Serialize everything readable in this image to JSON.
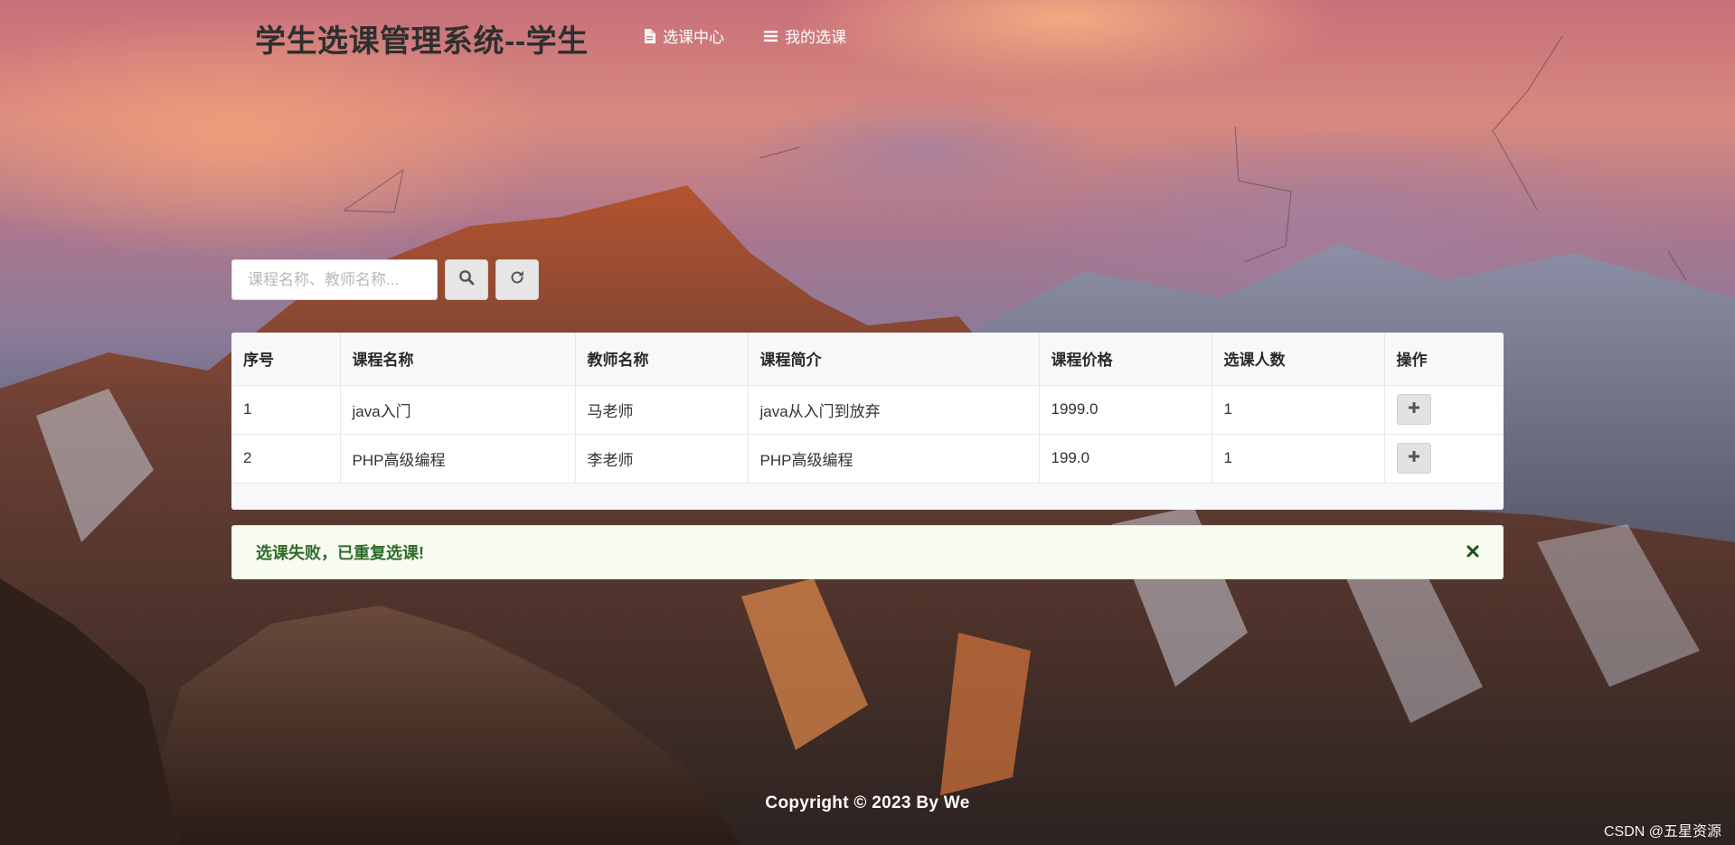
{
  "header": {
    "brand": "学生选课管理系统--学生",
    "nav": [
      {
        "label": "选课中心",
        "icon": "document-icon"
      },
      {
        "label": "我的选课",
        "icon": "list-icon"
      }
    ]
  },
  "search": {
    "placeholder": "课程名称、教师名称...",
    "value": "",
    "search_icon": "search-icon",
    "refresh_icon": "refresh-icon"
  },
  "table": {
    "columns": [
      "序号",
      "课程名称",
      "教师名称",
      "课程简介",
      "课程价格",
      "选课人数",
      "操作"
    ],
    "rows": [
      {
        "index": "1",
        "course": "java入门",
        "teacher": "马老师",
        "intro": "java从入门到放弃",
        "price": "1999.0",
        "count": "1",
        "action_icon": "plus-icon"
      },
      {
        "index": "2",
        "course": "PHP高级编程",
        "teacher": "李老师",
        "intro": "PHP高级编程",
        "price": "199.0",
        "count": "1",
        "action_icon": "plus-icon"
      }
    ]
  },
  "alert": {
    "message": "选课失败，已重复选课!",
    "close_icon": "close-icon"
  },
  "footer": {
    "copyright": "Copyright © 2023 By We",
    "watermark": "CSDN @五星资源"
  },
  "colors": {
    "alert_text": "#2f6b2a",
    "alert_bg": "#f7fbf0",
    "brand_text": "#2f2f2f"
  }
}
